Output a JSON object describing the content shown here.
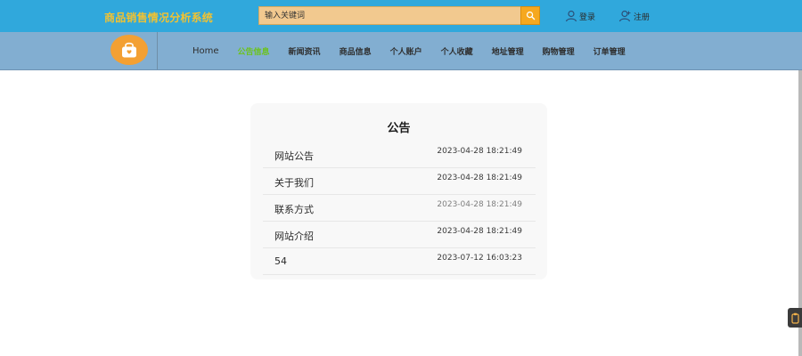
{
  "header": {
    "brand": "商品销售情况分析系统",
    "search_placeholder": "输入关键词",
    "login_label": "登录",
    "register_label": "注册"
  },
  "nav": {
    "items": [
      {
        "label": "Home"
      },
      {
        "label": "公告信息",
        "active": true
      },
      {
        "label": "新闻资讯"
      },
      {
        "label": "商品信息"
      },
      {
        "label": "个人账户"
      },
      {
        "label": "个人收藏"
      },
      {
        "label": "地址管理"
      },
      {
        "label": "购物管理"
      },
      {
        "label": "订单管理"
      }
    ]
  },
  "notices": {
    "title": "公告",
    "items": [
      {
        "title": "网站公告",
        "date": "2023-04-28 18:21:49"
      },
      {
        "title": "关于我们",
        "date": "2023-04-28 18:21:49"
      },
      {
        "title": "联系方式",
        "date": "2023-04-28 18:21:49"
      },
      {
        "title": "网站介绍",
        "date": "2023-04-28 18:21:49"
      },
      {
        "title": "54",
        "date": "2023-07-12 16:03:23"
      }
    ]
  },
  "colors": {
    "topbar": "#30a8dc",
    "brand": "#f1c232",
    "navbar": "#82aed1",
    "active_nav": "#6cc31d",
    "search_button": "#f6a81f",
    "logo": "#f3a033"
  },
  "icons": {
    "search": "search-icon",
    "login": "user-icon",
    "register": "user-add-icon",
    "logo": "shopping-bag-icon",
    "side_widget": "clipboard-icon"
  }
}
